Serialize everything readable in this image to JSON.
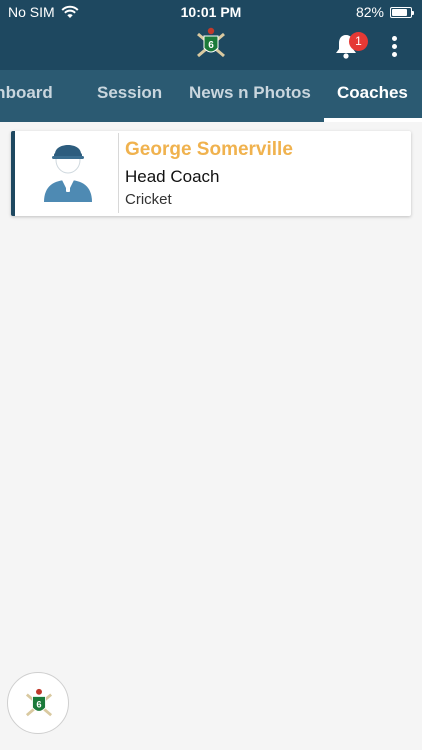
{
  "status_bar": {
    "carrier": "No SIM",
    "time": "10:01 PM",
    "battery": "82%",
    "battery_level": 0.82
  },
  "app_bar": {
    "notification_count": "1",
    "logo_text": "6"
  },
  "tabs": [
    {
      "label": "Dashboard",
      "active": false
    },
    {
      "label": "Session",
      "active": false
    },
    {
      "label": "News n Photos",
      "active": false
    },
    {
      "label": "Coaches",
      "active": true
    }
  ],
  "coaches": [
    {
      "name": "George Somerville",
      "role": "Head Coach",
      "sport": "Cricket"
    }
  ],
  "fab": {
    "logo_text": "6"
  },
  "colors": {
    "header": "#1e4860",
    "tab_bar": "#2b5a72",
    "accent_name": "#f0b24e",
    "badge": "#e53935",
    "background": "#f5f5f5"
  },
  "icons": {
    "wifi": "wifi-icon",
    "battery": "battery-icon",
    "bell": "bell-icon",
    "more": "more-vertical-icon",
    "avatar": "coach-avatar-icon",
    "logo": "cricket-logo-icon"
  }
}
